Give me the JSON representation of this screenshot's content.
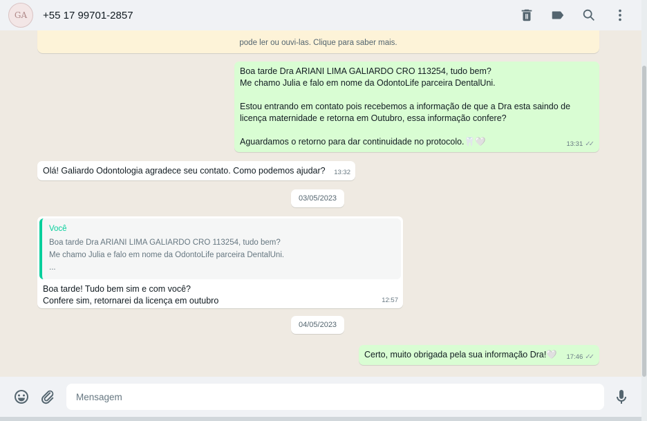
{
  "header": {
    "avatar_initials": "GA",
    "contact_name": "+55 17 99701-2857",
    "icons": [
      "delete-icon",
      "label-icon",
      "search-icon",
      "menu-icon"
    ]
  },
  "banner": {
    "text": "pode ler ou ouvi-las. Clique para saber mais."
  },
  "messages": [
    {
      "direction": "out",
      "text": "Boa tarde Dra ARIANI LIMA GALIARDO CRO 113254, tudo bem?\nMe chamo Julia e falo em nome da OdontoLife parceira DentalUni.\n\nEstou entrando em contato pois recebemos a informação de que a Dra esta saindo de licença maternidade e retorna em Outubro, essa informação confere?\n\nAguardamos o retorno para dar continuidade no protocolo.🦷🤍",
      "time": "13:31",
      "read": true
    },
    {
      "direction": "in",
      "text": "Olá! Galiardo Odontologia agradece seu contato. Como podemos ajudar?",
      "time": "13:32"
    },
    {
      "direction": "in",
      "quote": {
        "author": "Você",
        "text": "Boa tarde Dra ARIANI LIMA GALIARDO CRO 113254, tudo bem?\nMe chamo Julia e falo em nome da OdontoLife parceira DentalUni.\n..."
      },
      "text": "Boa tarde! Tudo bem sim e com você?\nConfere sim, retornarei da licença em outubro",
      "time": "12:57"
    },
    {
      "direction": "out",
      "text": "Certo, muito obrigada pela sua informação Dra!🤍",
      "time": "17:46",
      "read": true
    }
  ],
  "dates": [
    "03/05/2023",
    "04/05/2023"
  ],
  "footer": {
    "placeholder": "Mensagem",
    "icons": [
      "emoji-icon",
      "attach-icon",
      "mic-icon"
    ]
  },
  "colors": {
    "outgoing_bubble": "#d9fdd3",
    "incoming_bubble": "#ffffff",
    "chat_background": "#efeae2",
    "quote_accent": "#06cf9c",
    "banner": "#fdf3d8"
  }
}
